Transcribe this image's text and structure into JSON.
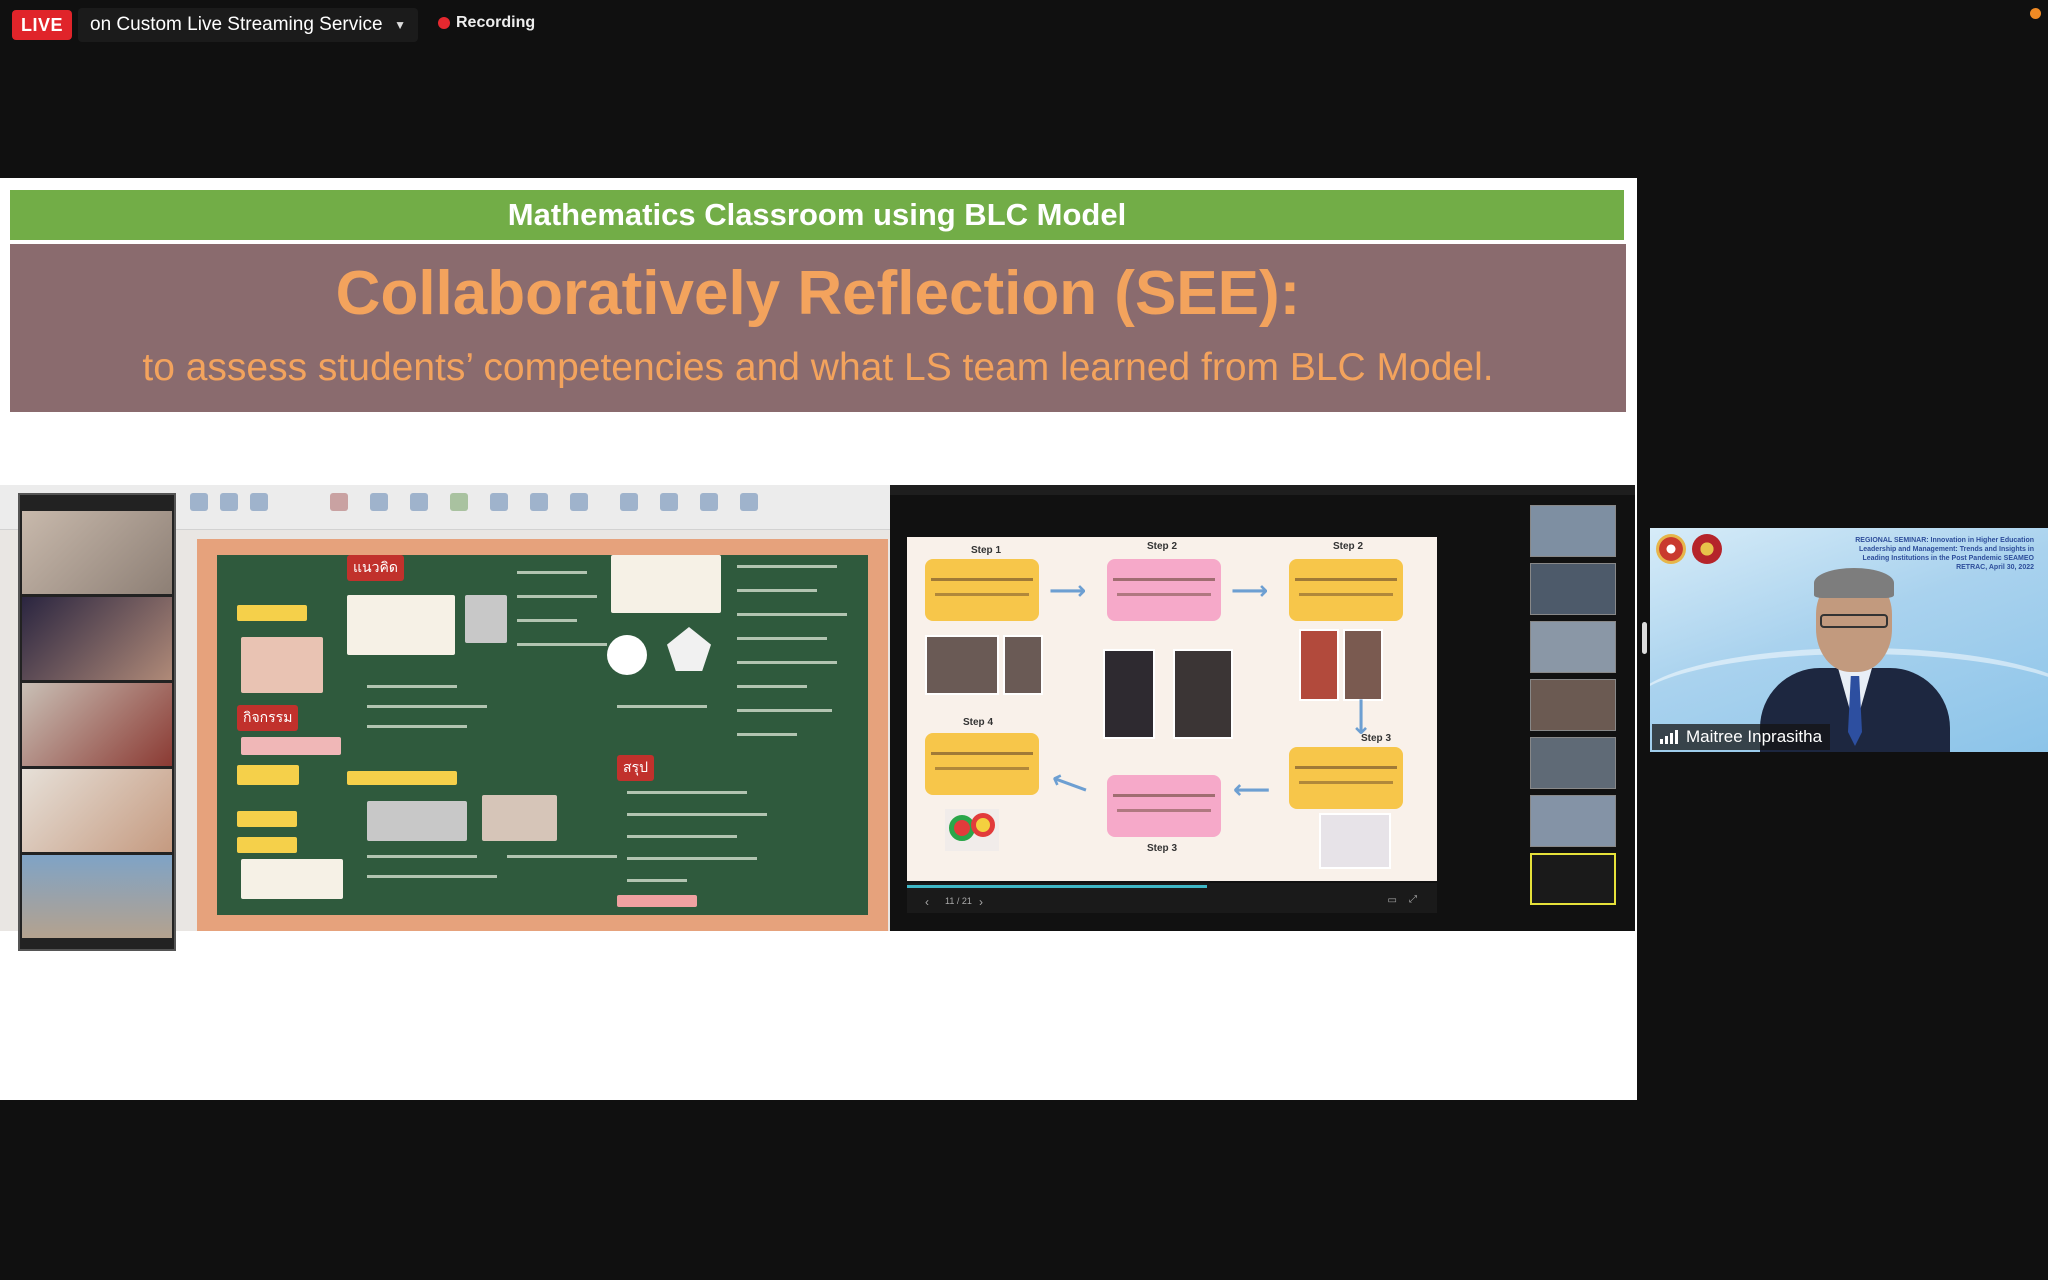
{
  "topbar": {
    "live_label": "LIVE",
    "stream_service": "on Custom Live Streaming Service",
    "recording_label": "Recording"
  },
  "shared_slide": {
    "banner": "Mathematics Classroom using BLC Model",
    "title": "Collaboratively Reflection (SEE):",
    "subtitle": "to assess students’ competencies and what LS team learned from BLC Model."
  },
  "embedded_left": {
    "board_tag_1": "แนวคิด",
    "board_tag_2": "สรุป"
  },
  "embedded_right": {
    "steps": [
      "Step 1",
      "Step 2",
      "Step 2",
      "Step 3",
      "Step 4",
      "Step 3"
    ],
    "page_indicator": "11 / 21"
  },
  "speaker": {
    "name": "Maitree Inprasitha",
    "seminar_text": "REGIONAL SEMINAR: Innovation in Higher Education Leadership and Management: Trends and Insights in Leading Institutions in the Post Pandemic SEAMEO RETRAC, April 30, 2022"
  },
  "colors": {
    "live_red": "#e0242a",
    "banner_green": "#72ad47",
    "panel_mauve": "#8a6b6e",
    "title_orange": "#f3a35d"
  }
}
